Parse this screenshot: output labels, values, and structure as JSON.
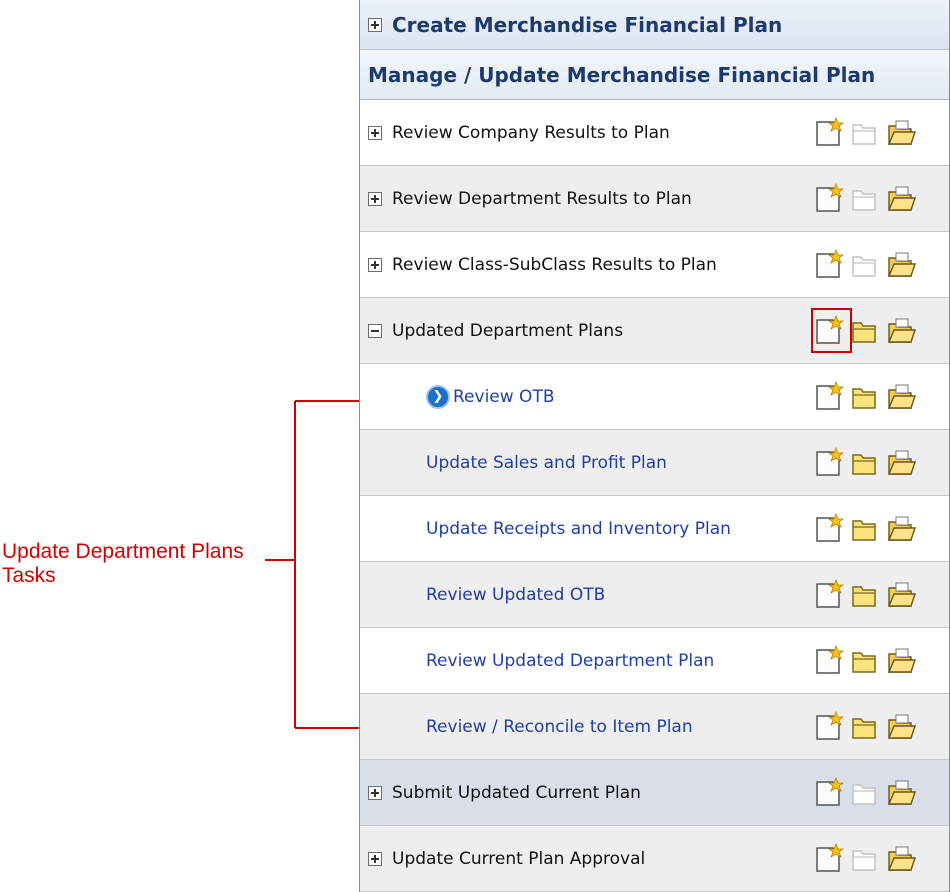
{
  "callout": {
    "label": "Update Department Plans Tasks"
  },
  "panel": {
    "headers": [
      {
        "label": "Create Merchandise Financial Plan",
        "toggle": "plus"
      },
      {
        "label": "Manage / Update Merchandise Financial Plan"
      }
    ],
    "rows": [
      {
        "label": "Review Company Results to Plan",
        "toggle": "plus",
        "open_enabled": false
      },
      {
        "label": "Review Department Results to Plan",
        "toggle": "plus",
        "open_enabled": false
      },
      {
        "label": "Review Class-SubClass Results to Plan",
        "toggle": "plus",
        "open_enabled": false
      },
      {
        "label": "Updated Department Plans",
        "toggle": "minus",
        "open_enabled": true,
        "highlighted_icon": "new-workbook-icon"
      },
      {
        "label": "Review OTB",
        "child": true,
        "current_step": true,
        "open_enabled": true
      },
      {
        "label": "Update Sales and Profit Plan",
        "child": true,
        "open_enabled": true
      },
      {
        "label": "Update Receipts and Inventory Plan",
        "child": true,
        "open_enabled": true
      },
      {
        "label": "Review Updated OTB",
        "child": true,
        "open_enabled": true
      },
      {
        "label": "Review Updated Department Plan",
        "child": true,
        "open_enabled": true
      },
      {
        "label": "Review / Reconcile to Item Plan",
        "child": true,
        "open_enabled": true
      },
      {
        "label": "Submit Updated Current Plan",
        "toggle": "plus",
        "open_enabled": false,
        "selected": true
      },
      {
        "label": "Update Current Plan Approval",
        "toggle": "plus",
        "open_enabled": false
      }
    ]
  },
  "icons": [
    "new-workbook-icon",
    "open-workbook-icon",
    "open-folder-icon"
  ],
  "colors": {
    "callout": "#d10000",
    "task_link": "#1f3fa6",
    "header_text": "#1c3a6e"
  }
}
